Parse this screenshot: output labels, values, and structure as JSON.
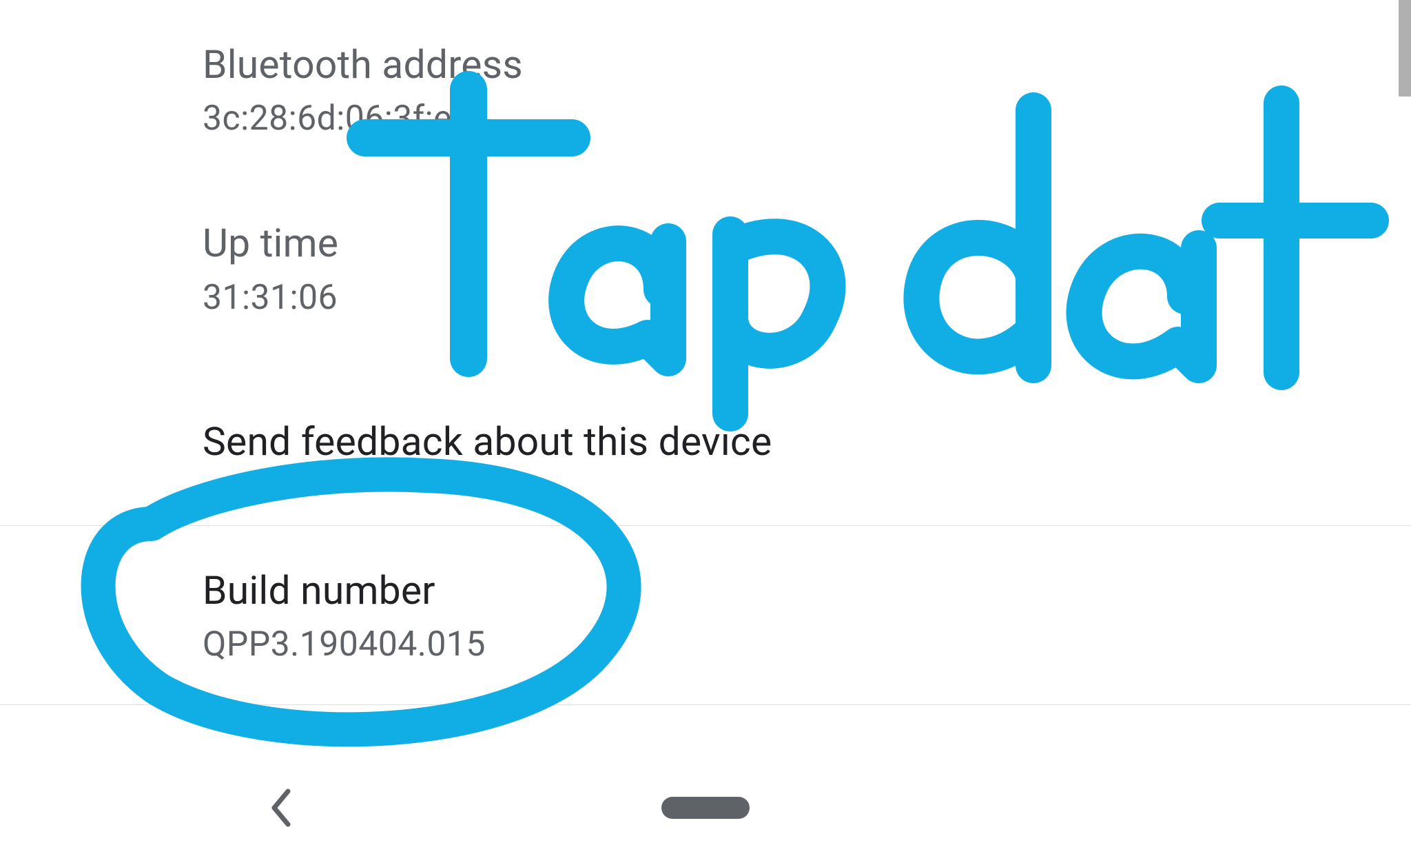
{
  "settings": {
    "bluetooth_address": {
      "label": "Bluetooth address",
      "value": "3c:28:6d:06:3f:e7"
    },
    "up_time": {
      "label": "Up time",
      "value": "31:31:06"
    },
    "send_feedback": {
      "label": "Send feedback about this device"
    },
    "build_number": {
      "label": "Build number",
      "value": "QPP3.190404.015"
    }
  },
  "annotation": {
    "text": "Tap dat",
    "color": "#11aee5"
  }
}
